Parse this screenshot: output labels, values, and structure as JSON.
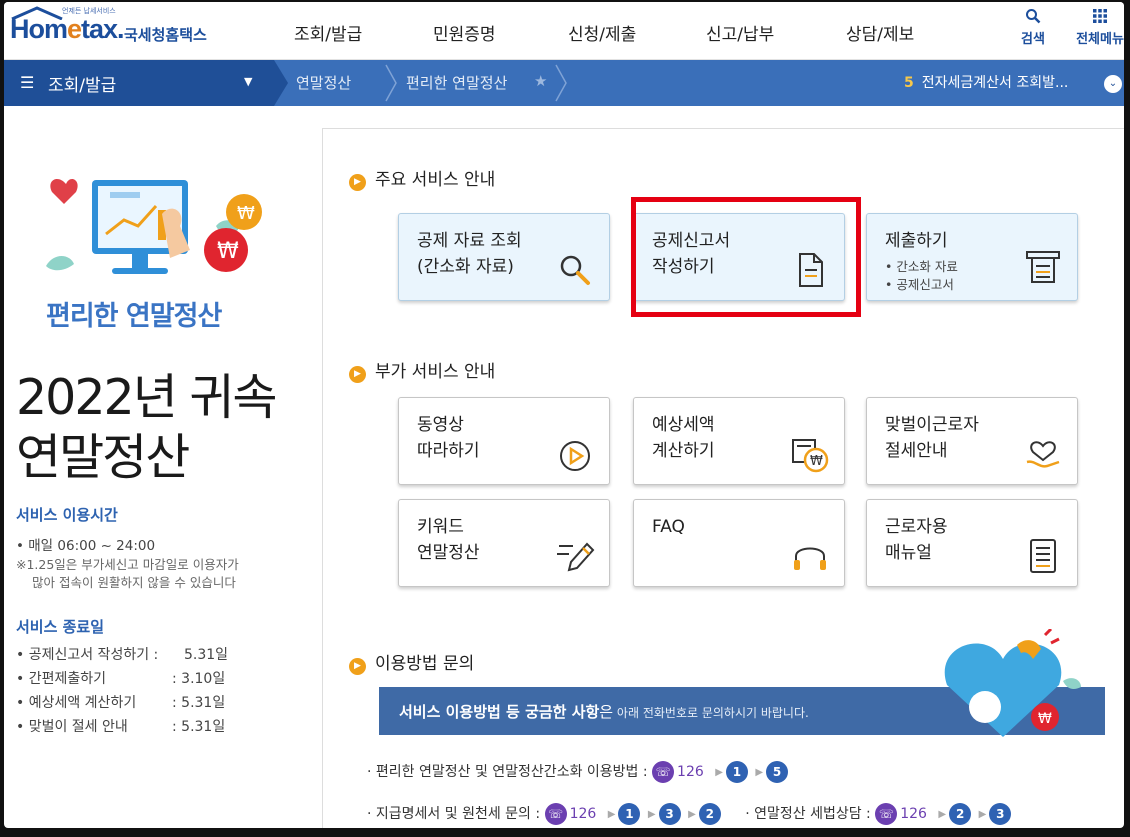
{
  "brand": {
    "sub": "언제든 납세서비스",
    "logo": "Hometax",
    "name": "국세청홈택스"
  },
  "menu": [
    "조회/발급",
    "민원증명",
    "신청/제출",
    "신고/납부",
    "상담/제보"
  ],
  "tools": {
    "search": "검색",
    "all_menu": "전체메뉴"
  },
  "crumbs": {
    "home": "조회/발급",
    "level1": "연말정산",
    "level2": "편리한 연말정산"
  },
  "recent": {
    "count": "5",
    "text": "전자세금계산서 조회발..."
  },
  "left": {
    "title": "편리한 연말정산",
    "big_line1": "2022년 귀속",
    "big_line2": "연말정산",
    "hours_title": "서비스 이용시간",
    "hours": "• 매일 06:00 ~ 24:00",
    "note1": "※1.25일은 부가세신고 마감일로 이용자가",
    "note2": "많아 접속이 원활하지 않을 수 있습니다",
    "end_title": "서비스 종료일",
    "end_items": [
      {
        "label": "• 공제신고서 작성하기 :",
        "date": "5.31일"
      },
      {
        "label": "• 간편제출하기",
        "date": ":  3.10일"
      },
      {
        "label": "• 예상세액 계산하기",
        "date": ":  5.31일"
      },
      {
        "label": "• 맞벌이 절세 안내",
        "date": ":  5.31일"
      }
    ]
  },
  "main": {
    "sec1": "주요 서비스 안내",
    "sec2": "부가 서비스 안내",
    "sec3": "이용방법 문의",
    "cards1": [
      {
        "l1": "공제 자료 조회",
        "l2": "(간소화 자료)"
      },
      {
        "l1": "공제신고서",
        "l2": "작성하기"
      },
      {
        "l1": "제출하기",
        "s1": "• 간소화 자료",
        "s2": "• 공제신고서"
      }
    ],
    "cards2": [
      {
        "l1": "동영상",
        "l2": "따라하기"
      },
      {
        "l1": "예상세액",
        "l2": "계산하기"
      },
      {
        "l1": "맞벌이근로자",
        "l2": "절세안내"
      },
      {
        "l1": "키워드",
        "l2": "연말정산"
      },
      {
        "l1": "FAQ",
        "l2": ""
      },
      {
        "l1": "근로자용",
        "l2": "매뉴얼"
      }
    ],
    "banner_bold": "서비스 이용방법 등 궁금한 사항",
    "banner_mid": "은",
    "banner_small": " 아래 전화번호로 문의하시기 바랍니다.",
    "phone1": "· 편리한 연말정산 및 연말정산간소화 이용방법 :",
    "phone2": "· 지급명세서 및 원천세 문의 :",
    "phone3": "· 연말정산 세법상담 :",
    "tel": "126",
    "codes1": [
      "1",
      "5"
    ],
    "codes2": [
      "1",
      "3",
      "2"
    ],
    "codes3": [
      "2",
      "3"
    ]
  }
}
